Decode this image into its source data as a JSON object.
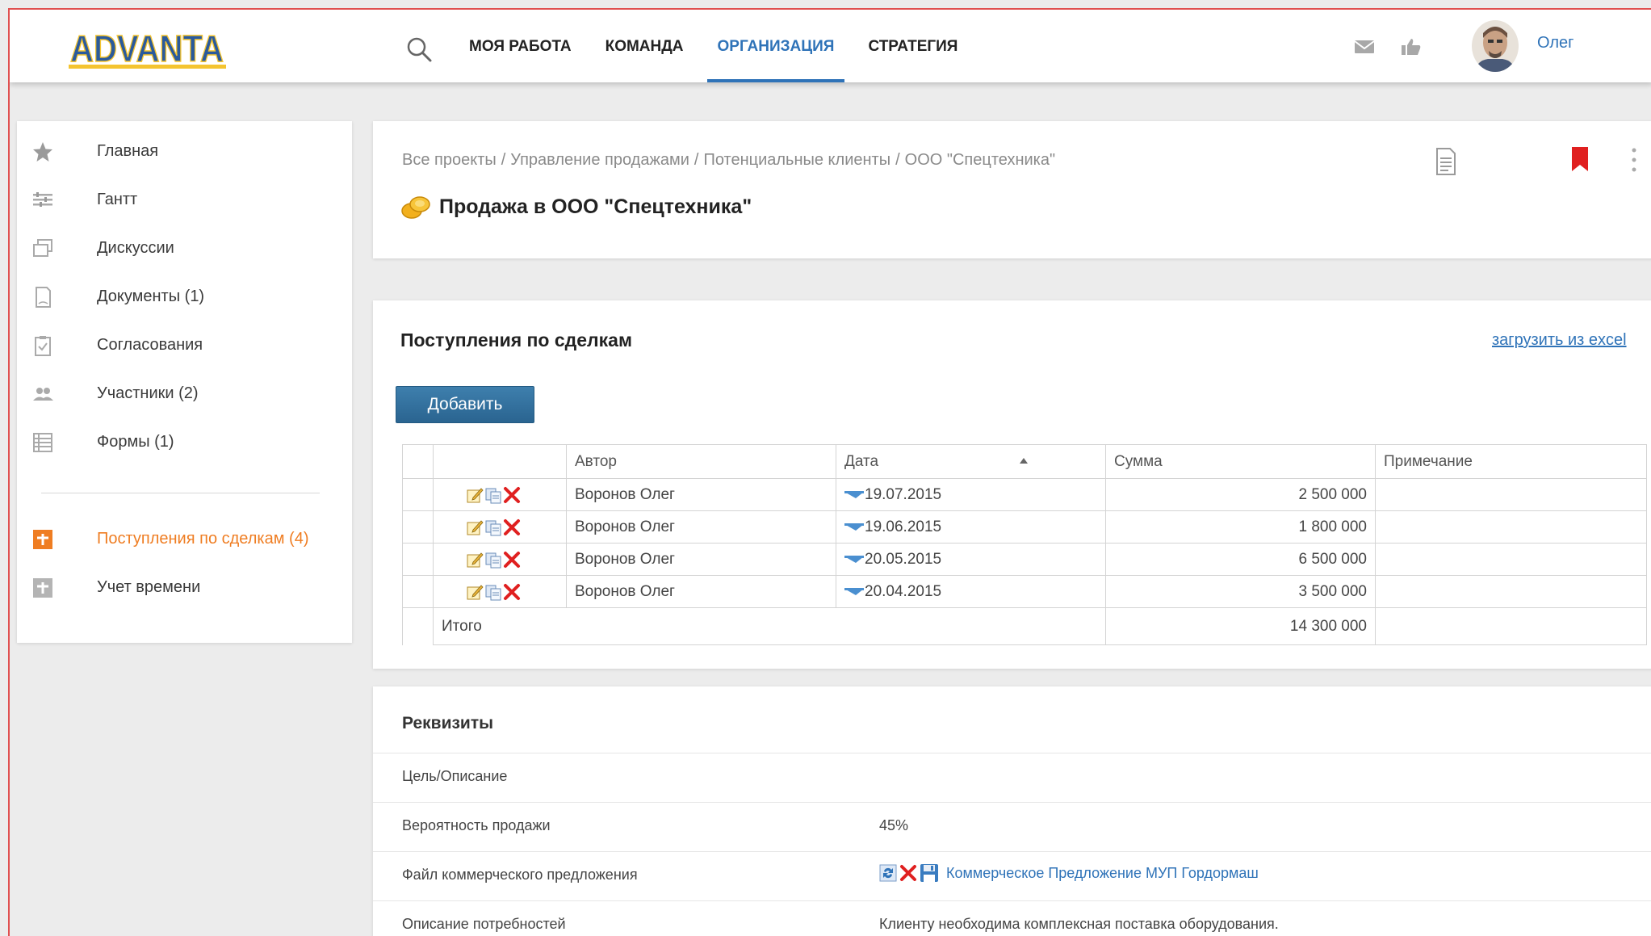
{
  "header": {
    "logo_text": "ADVANTA",
    "nav": [
      {
        "label": "МОЯ РАБОТА",
        "active": false
      },
      {
        "label": "КОМАНДА",
        "active": false
      },
      {
        "label": "ОРГАНИЗАЦИЯ",
        "active": true
      },
      {
        "label": "СТРАТЕГИЯ",
        "active": false
      }
    ],
    "user_name": "Олег"
  },
  "sidebar": {
    "items": [
      {
        "label": "Главная",
        "icon": "star-icon"
      },
      {
        "label": "Гантт",
        "icon": "gantt-icon"
      },
      {
        "label": "Дискуссии",
        "icon": "discussions-icon"
      },
      {
        "label": "Документы (1)",
        "icon": "document-icon"
      },
      {
        "label": "Согласования",
        "icon": "approval-icon"
      },
      {
        "label": "Участники (2)",
        "icon": "participants-icon"
      },
      {
        "label": "Формы (1)",
        "icon": "forms-icon"
      }
    ],
    "extra_items": [
      {
        "label": "Поступления по сделкам (4)",
        "icon": "plus-box-icon",
        "active": true
      },
      {
        "label": "Учет времени",
        "icon": "plus-box-icon",
        "active": false
      }
    ]
  },
  "breadcrumb": [
    "Все проекты",
    "Управление продажами",
    "Потенциальные клиенты",
    "ООО \"Спецтехника\""
  ],
  "breadcrumb_separator": "/",
  "page_title": "Продажа в ООО \"Спецтехника\"",
  "deals": {
    "title": "Поступления по сделкам",
    "excel_link": "загрузить из excel",
    "add_button": "Добавить",
    "columns": [
      "Автор",
      "Дата",
      "Сумма",
      "Примечание"
    ],
    "rows": [
      {
        "author": "Воронов Олег",
        "date": "19.07.2015",
        "amount": "2 500 000",
        "note": ""
      },
      {
        "author": "Воронов Олег",
        "date": "19.06.2015",
        "amount": "1 800 000",
        "note": ""
      },
      {
        "author": "Воронов Олег",
        "date": "20.05.2015",
        "amount": "6 500 000",
        "note": ""
      },
      {
        "author": "Воронов Олег",
        "date": "20.04.2015",
        "amount": "3 500 000",
        "note": ""
      }
    ],
    "total_label": "Итого",
    "total_amount": "14 300 000"
  },
  "requisites": {
    "title": "Реквизиты",
    "rows": [
      {
        "label": "Цель/Описание",
        "value": ""
      },
      {
        "label": "Вероятность продажи",
        "value": "45%"
      },
      {
        "label": "Файл коммерческого предложения",
        "value": "Коммерческое Предложение МУП Гордормаш"
      },
      {
        "label": "Описание потребностей",
        "value": "Клиенту необходима комплексная поставка оборудования."
      }
    ]
  },
  "colors": {
    "accent_blue": "#2f73b8",
    "active_orange": "#ef7d22",
    "button_blue": "#2a6490",
    "bookmark_red": "#e02020"
  }
}
